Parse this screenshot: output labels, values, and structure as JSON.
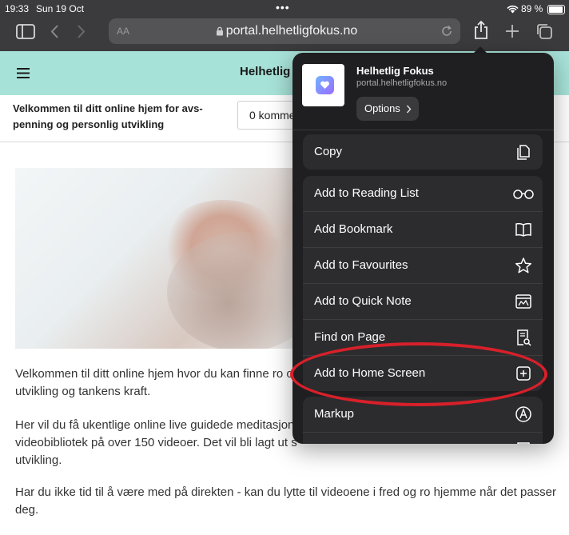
{
  "status": {
    "time": "19:33",
    "date": "Sun 19 Oct",
    "battery": "89 %"
  },
  "browser": {
    "text_size_label": "AA",
    "url": "portal.helhetligfokus.no"
  },
  "site": {
    "title": "Helhetlig",
    "welcome": "Velkommen til ditt online hjem for avs-penning og personlig utvikling",
    "comments": "0 komme",
    "paragraphs": [
      "Velkommen til ditt online hjem hvor du kan finne ro og",
      "utvikling og tankens kraft.",
      "Her vil du få ukentlige online live guidede meditasjon",
      "videobibliotek på over 150 videoer. Det vil bli lagt ut s",
      "utvikling.",
      "Har du ikke tid til å være med på direkten - kan du lytte til videoene i fred og ro hjemme når det passer",
      "deg."
    ]
  },
  "share_sheet": {
    "app_name": "Helhetlig Fokus",
    "app_url": "portal.helhetligfokus.no",
    "options_label": "Options",
    "copy_label": "Copy",
    "actions": [
      {
        "label": "Add to Reading List",
        "icon": "glasses-icon"
      },
      {
        "label": "Add Bookmark",
        "icon": "book-icon"
      },
      {
        "label": "Add to Favourites",
        "icon": "star-icon"
      },
      {
        "label": "Add to Quick Note",
        "icon": "quick-note-icon"
      },
      {
        "label": "Find on Page",
        "icon": "find-doc-icon"
      },
      {
        "label": "Add to Home Screen",
        "icon": "plus-square-icon"
      }
    ],
    "markup_label": "Markup"
  },
  "colors": {
    "annotation": "#d8202a",
    "header_teal": "#a7e2d8",
    "sheet_bg": "#1f1f21"
  }
}
